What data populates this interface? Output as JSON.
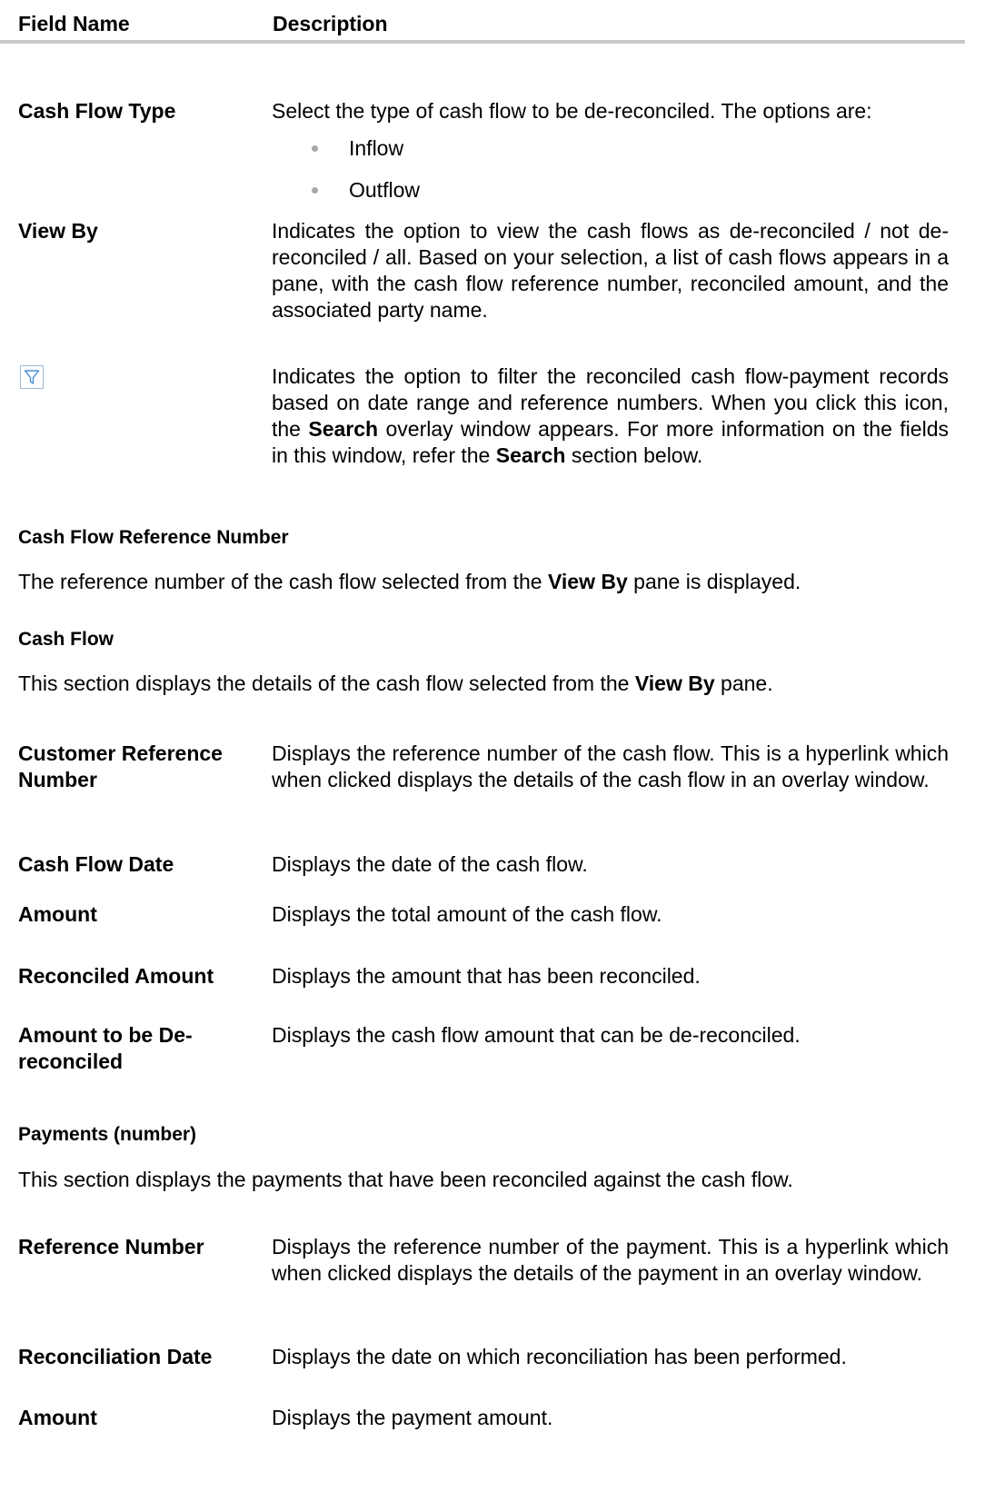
{
  "header": {
    "field_name": "Field Name",
    "description": "Description"
  },
  "fields_top": [
    {
      "label": "Cash Flow Type",
      "desc": "Select the type of cash flow to be de-reconciled. The options are:",
      "options": [
        "Inflow",
        "Outflow"
      ]
    },
    {
      "label": "View By",
      "desc": "Indicates the option to view the cash flows as de-reconciled / not de-reconciled / all. Based on your selection, a list of cash flows appears in a pane, with the cash flow reference number, reconciled amount, and the associated party name."
    },
    {
      "icon": "filter-icon",
      "desc_parts": [
        "Indicates the option to filter the reconciled cash flow-payment records based on date range and reference numbers. When you click this icon, the ",
        "Search",
        " overlay window appears. For more information on the fields in this window, refer the ",
        "Search",
        " section below."
      ]
    }
  ],
  "section_ref": {
    "title": "Cash Flow Reference Number",
    "text_parts": [
      "The reference number of the cash flow selected from the ",
      "View By",
      " pane is displayed."
    ]
  },
  "section_cashflow": {
    "title": "Cash Flow",
    "text_parts": [
      "This section displays the details of the cash flow selected from the ",
      "View By",
      " pane."
    ]
  },
  "fields_cashflow": [
    {
      "label": "Customer Reference Number",
      "desc": "Displays the reference number of the cash flow. This is a hyperlink which when clicked displays the details of the cash flow in an overlay window."
    },
    {
      "label": "Cash Flow Date",
      "desc": "Displays the date of the cash flow."
    },
    {
      "label": "Amount",
      "desc": "Displays the total amount of the cash flow."
    },
    {
      "label": "Reconciled Amount",
      "desc": "Displays the amount that has been reconciled."
    },
    {
      "label": "Amount to be De-reconciled",
      "desc": "Displays the cash flow amount that can be de-reconciled."
    }
  ],
  "section_payments": {
    "title": "Payments (number)",
    "text": "This section displays the payments that have been reconciled against the cash flow."
  },
  "fields_payments": [
    {
      "label": "Reference Number",
      "desc": "Displays the reference number of the payment. This is a hyperlink which when clicked displays the details of the payment in an overlay window."
    },
    {
      "label": "Reconciliation Date",
      "desc": "Displays the date on which reconciliation has been performed."
    },
    {
      "label": "Amount",
      "desc": "Displays the payment amount."
    }
  ]
}
